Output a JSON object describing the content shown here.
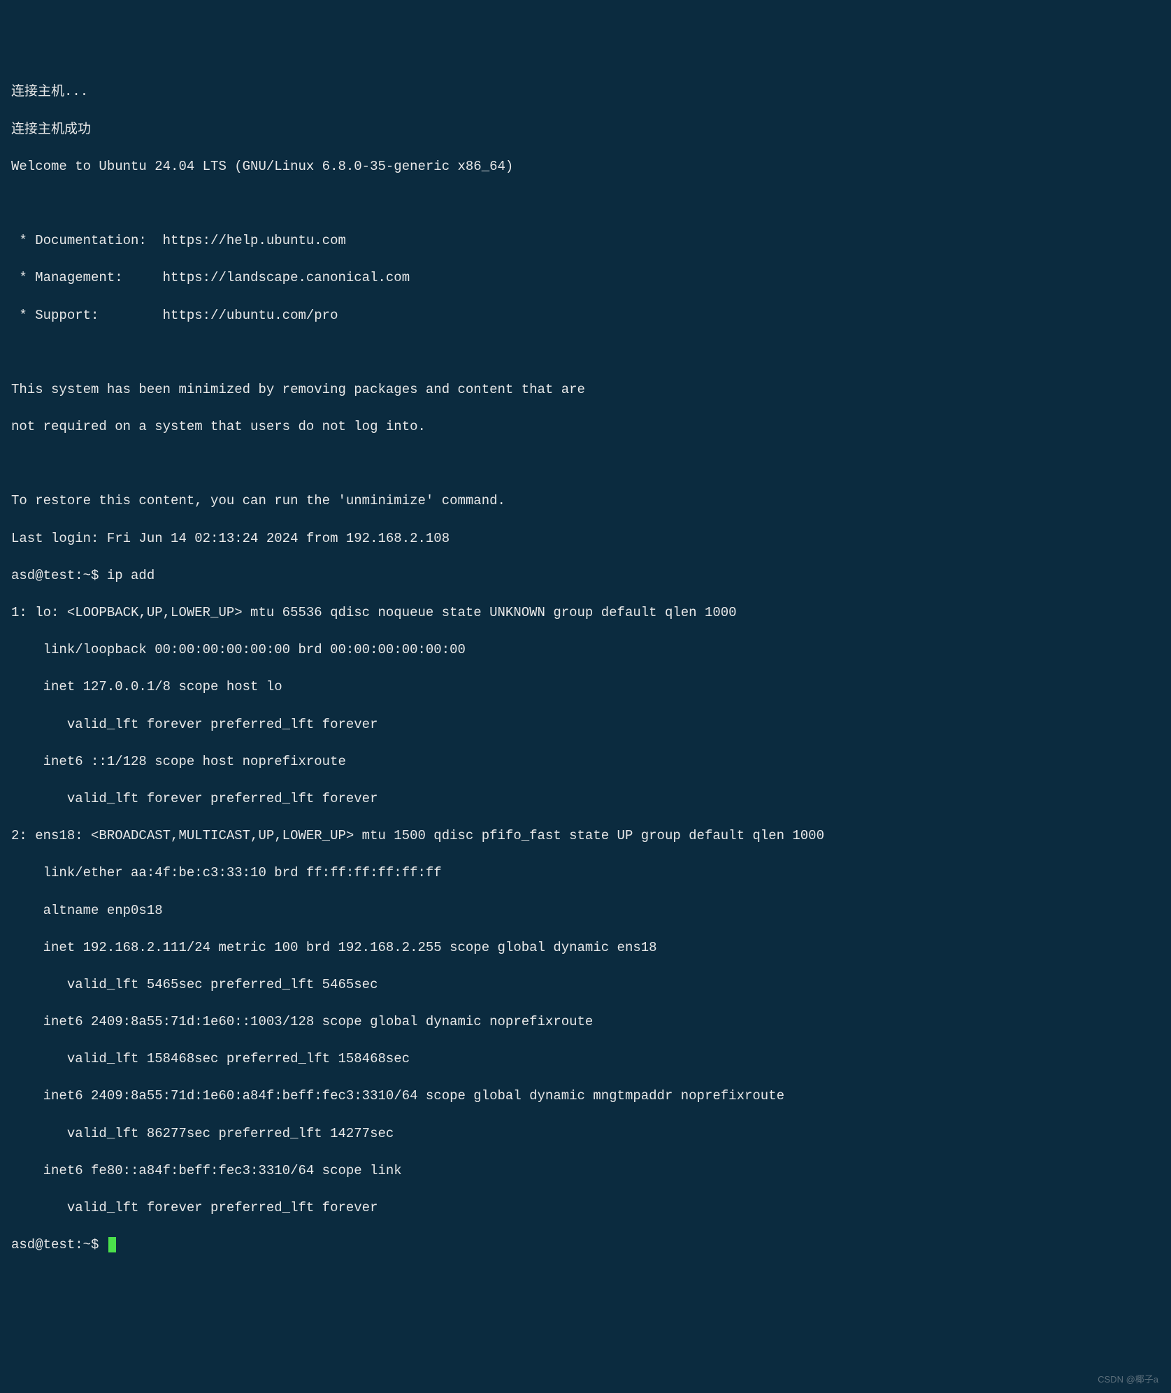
{
  "connection": {
    "connecting": "连接主机...",
    "connected": "连接主机成功"
  },
  "welcome": "Welcome to Ubuntu 24.04 LTS (GNU/Linux 6.8.0-35-generic x86_64)",
  "links": {
    "doc": " * Documentation:  https://help.ubuntu.com",
    "mgmt": " * Management:     https://landscape.canonical.com",
    "support": " * Support:        https://ubuntu.com/pro"
  },
  "minimized": {
    "line1": "This system has been minimized by removing packages and content that are",
    "line2": "not required on a system that users do not log into.",
    "restore": "To restore this content, you can run the 'unminimize' command."
  },
  "lastlogin": "Last login: Fri Jun 14 02:13:24 2024 from 192.168.2.108",
  "prompt1": {
    "user_host": "asd@test:~$ ",
    "command": "ip add"
  },
  "ip_output": {
    "lo_header": "1: lo: <LOOPBACK,UP,LOWER_UP> mtu 65536 qdisc noqueue state UNKNOWN group default qlen 1000",
    "lo_link": "    link/loopback 00:00:00:00:00:00 brd 00:00:00:00:00:00",
    "lo_inet": "    inet 127.0.0.1/8 scope host lo",
    "lo_inet_lft": "       valid_lft forever preferred_lft forever",
    "lo_inet6": "    inet6 ::1/128 scope host noprefixroute",
    "lo_inet6_lft": "       valid_lft forever preferred_lft forever",
    "ens_header": "2: ens18: <BROADCAST,MULTICAST,UP,LOWER_UP> mtu 1500 qdisc pfifo_fast state UP group default qlen 1000",
    "ens_link": "    link/ether aa:4f:be:c3:33:10 brd ff:ff:ff:ff:ff:ff",
    "ens_altname": "    altname enp0s18",
    "ens_inet": "    inet 192.168.2.111/24 metric 100 brd 192.168.2.255 scope global dynamic ens18",
    "ens_inet_lft": "       valid_lft 5465sec preferred_lft 5465sec",
    "ens_inet6a": "    inet6 2409:8a55:71d:1e60::1003/128 scope global dynamic noprefixroute",
    "ens_inet6a_lft": "       valid_lft 158468sec preferred_lft 158468sec",
    "ens_inet6b": "    inet6 2409:8a55:71d:1e60:a84f:beff:fec3:3310/64 scope global dynamic mngtmpaddr noprefixroute",
    "ens_inet6b_lft": "       valid_lft 86277sec preferred_lft 14277sec",
    "ens_inet6c": "    inet6 fe80::a84f:beff:fec3:3310/64 scope link",
    "ens_inet6c_lft": "       valid_lft forever preferred_lft forever"
  },
  "prompt2": {
    "user_host": "asd@test:~$ "
  },
  "watermark": "CSDN @椰子a"
}
